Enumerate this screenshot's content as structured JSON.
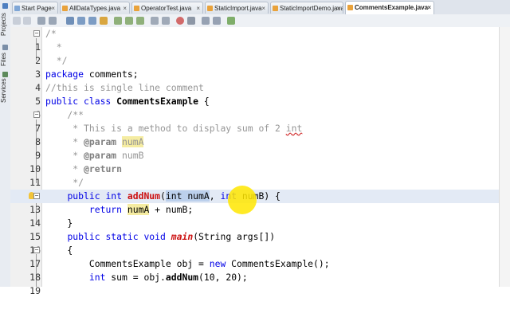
{
  "side_tabs": {
    "projects": "Projects",
    "files": "Files",
    "services": "Services"
  },
  "tabs": [
    {
      "label": "Start Page",
      "active": false
    },
    {
      "label": "AllDataTypes.java",
      "active": false
    },
    {
      "label": "OperatorTest.java",
      "active": false
    },
    {
      "label": "StaticImport.java",
      "active": false
    },
    {
      "label": "StaticImportDemo.java",
      "active": false
    },
    {
      "label": "CommentsExample.java",
      "active": true
    }
  ],
  "editor": {
    "line_numbers": [
      "1",
      "2",
      "3",
      "4",
      "5",
      "6",
      "7",
      "8",
      "9",
      "10",
      "11",
      "12",
      "13",
      "14",
      "15",
      "16",
      "17",
      "18",
      "19"
    ],
    "t": {
      "l1": "/*",
      "l2": "  *",
      "l3": "  */",
      "l4_kw": "package",
      "l4_rest": " comments;",
      "l5": "//this is single line comment",
      "l6_kw": "public class",
      "l6_cls": "CommentsExample",
      "l6_rest": " {",
      "l7": "    /**",
      "l8_a": "     * This is a method to display sum of 2 ",
      "l8_b": "int",
      "l9_a": "     * ",
      "l9_tag": "@param",
      "l9_sp": " ",
      "l9_p": "numA",
      "l10_a": "     * ",
      "l10_tag": "@param",
      "l10_rest": " numB",
      "l11_a": "     * ",
      "l11_tag": "@return",
      "l12": "     */",
      "l13_a": "    ",
      "l13_kw1": "public int",
      "l13_sp": " ",
      "l13_m": "addNum",
      "l13_p": "(",
      "l13_sel1": "int numA",
      "l13_c": ", ",
      "l13_sel2": "int",
      "l13_rest": " numB) {",
      "l14_a": "        ",
      "l14_kw": "return",
      "l14_sp": " ",
      "l14_p": "numA",
      "l14_rest": " + numB;",
      "l15": "    }",
      "l16_a": "    ",
      "l16_kw": "public static void",
      "l16_sp": " ",
      "l16_m": "main",
      "l16_rest": "(String args[])",
      "l17": "    {",
      "l18_a": "        CommentsExample obj = ",
      "l18_kw": "new",
      "l18_rest": " CommentsExample();",
      "l19_a": "        ",
      "l19_kw": "int",
      "l19_b": " sum = obj.",
      "l19_m": "addNum",
      "l19_rest": "(10, 20);"
    }
  },
  "colors": {
    "keyword": "#0000e6",
    "comment": "#969696",
    "method_decl": "#cc1010",
    "occurrence_highlight": "#f5eca2",
    "selection": "#bcd0ec",
    "current_line": "#e3eaf5",
    "cursor_highlight": "#ffe600"
  },
  "icons": [
    "projects-icon",
    "files-icon",
    "services-icon",
    "java-file-icon",
    "close-icon",
    "back-icon",
    "forward-icon",
    "search-icon",
    "toggle-bookmark-icon",
    "shift-left-icon",
    "shift-right-icon",
    "record-macro-icon",
    "comment-icon",
    "uncomment-icon",
    "lightbulb-icon"
  ]
}
